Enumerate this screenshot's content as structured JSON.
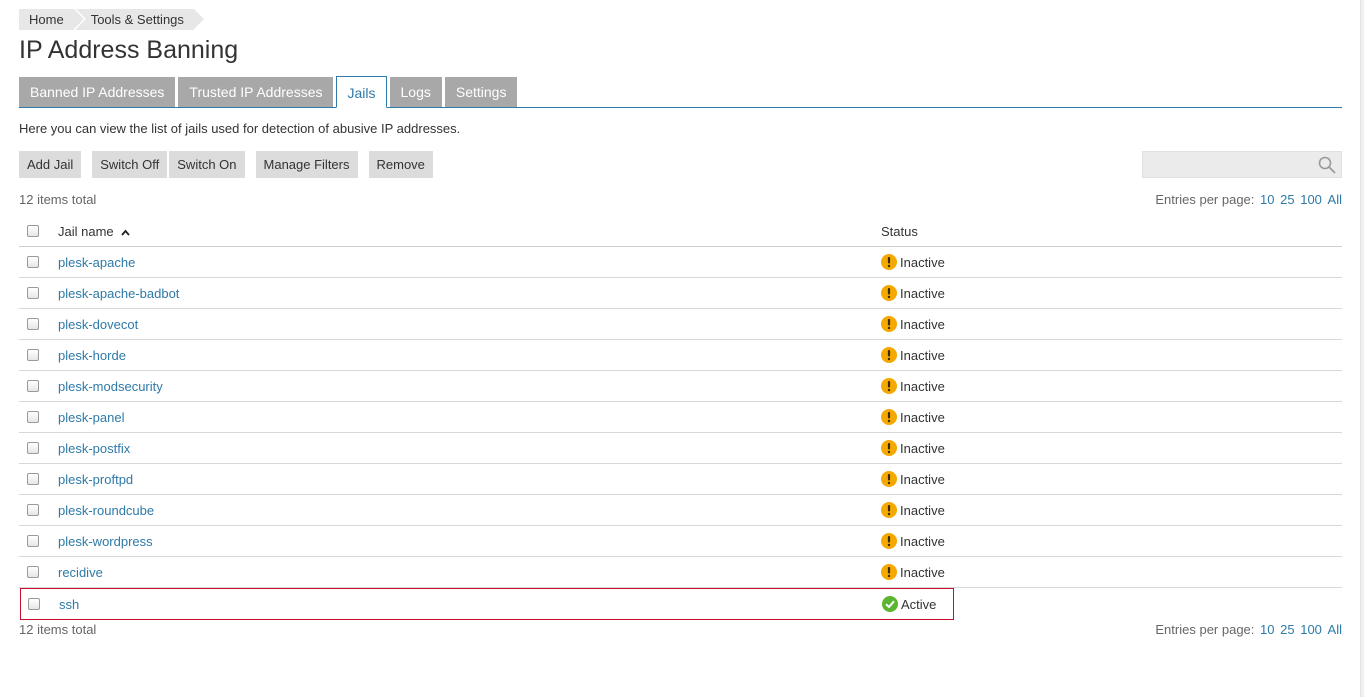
{
  "breadcrumb": {
    "home": "Home",
    "tools": "Tools & Settings"
  },
  "page_title": "IP Address Banning",
  "tabs": [
    {
      "label": "Banned IP Addresses",
      "active": false
    },
    {
      "label": "Trusted IP Addresses",
      "active": false
    },
    {
      "label": "Jails",
      "active": true
    },
    {
      "label": "Logs",
      "active": false
    },
    {
      "label": "Settings",
      "active": false
    }
  ],
  "hint": "Here you can view the list of jails used for detection of abusive IP addresses.",
  "toolbar": {
    "add_jail": "Add Jail",
    "switch_off": "Switch Off",
    "switch_on": "Switch On",
    "manage_filters": "Manage Filters",
    "remove": "Remove"
  },
  "search": {
    "placeholder": "",
    "icon": "search-icon"
  },
  "items_total": "12 items total",
  "entries": {
    "label": "Entries per page:",
    "options": [
      "10",
      "25",
      "100",
      "All"
    ]
  },
  "table": {
    "col_name": "Jail name",
    "col_status": "Status",
    "rows": [
      {
        "name": "plesk-apache",
        "status": "Inactive"
      },
      {
        "name": "plesk-apache-badbot",
        "status": "Inactive"
      },
      {
        "name": "plesk-dovecot",
        "status": "Inactive"
      },
      {
        "name": "plesk-horde",
        "status": "Inactive"
      },
      {
        "name": "plesk-modsecurity",
        "status": "Inactive"
      },
      {
        "name": "plesk-panel",
        "status": "Inactive"
      },
      {
        "name": "plesk-postfix",
        "status": "Inactive"
      },
      {
        "name": "plesk-proftpd",
        "status": "Inactive"
      },
      {
        "name": "plesk-roundcube",
        "status": "Inactive"
      },
      {
        "name": "plesk-wordpress",
        "status": "Inactive"
      },
      {
        "name": "recidive",
        "status": "Inactive"
      },
      {
        "name": "ssh",
        "status": "Active"
      }
    ]
  },
  "colors": {
    "accent": "#2e7aa8",
    "warning": "#f5a800",
    "active": "#5cb531",
    "highlight": "#c8102e"
  }
}
